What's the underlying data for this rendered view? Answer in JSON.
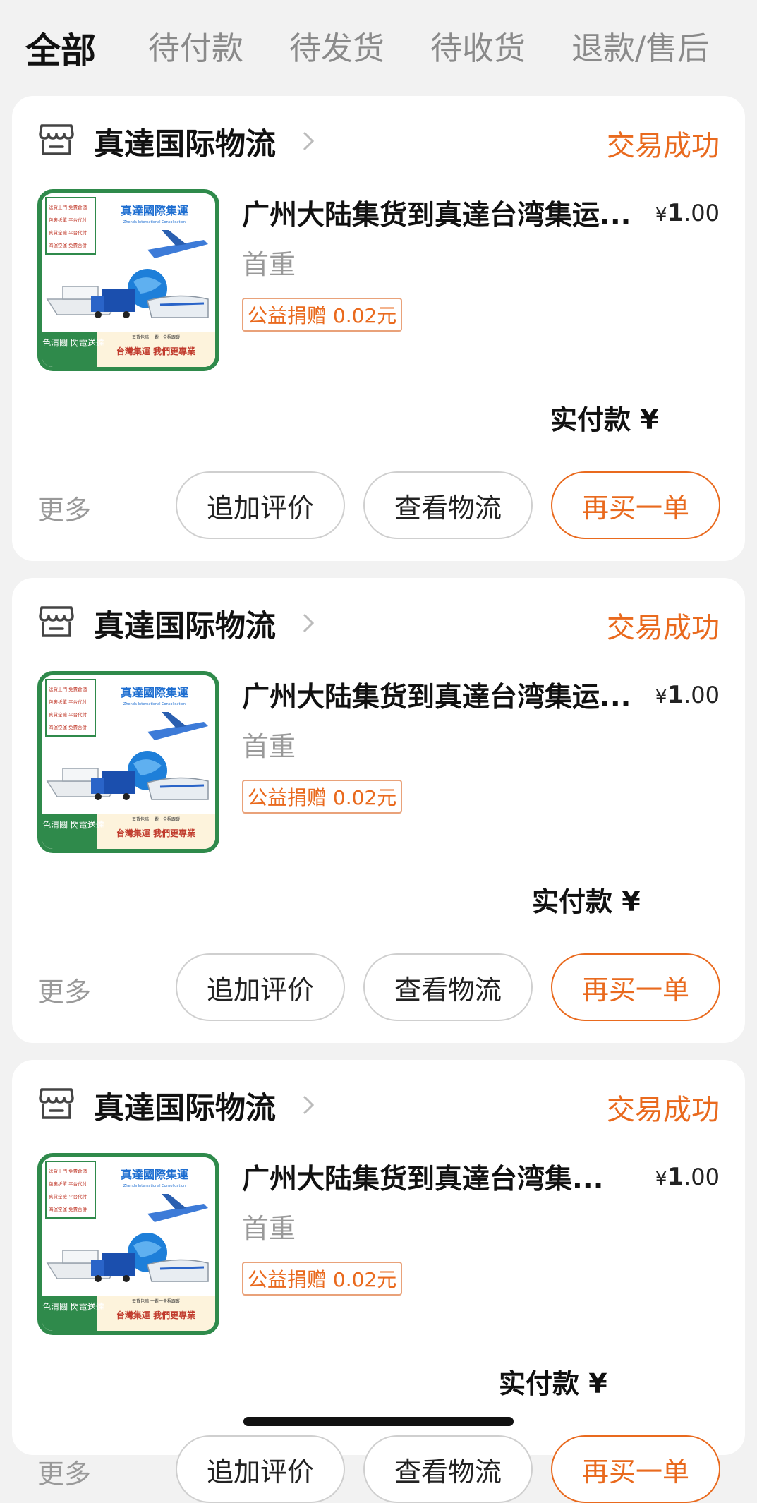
{
  "tabs": [
    {
      "label": "全部",
      "active": true
    },
    {
      "label": "待付款",
      "active": false
    },
    {
      "label": "待发货",
      "active": false
    },
    {
      "label": "待收货",
      "active": false
    },
    {
      "label": "退款/售后",
      "active": false
    }
  ],
  "orders": [
    {
      "shop": "真達国际物流",
      "status": "交易成功",
      "title": "广州大陆集货到真達台湾集运...",
      "price_currency": "¥",
      "price_int": "1",
      "price_dec": ".00",
      "spec": "首重",
      "charity": "公益捐赠 0.02元",
      "paid_label": "实付款 ¥",
      "more": "更多",
      "buttons": [
        "追加评价",
        "查看物流",
        "再买一单"
      ]
    },
    {
      "shop": "真達国际物流",
      "status": "交易成功",
      "title": "广州大陆集货到真達台湾集运...",
      "price_currency": "¥",
      "price_int": "1",
      "price_dec": ".00",
      "spec": "首重",
      "charity": "公益捐赠 0.02元",
      "paid_label": "实付款 ¥",
      "more": "更多",
      "buttons": [
        "追加评价",
        "查看物流",
        "再买一单"
      ]
    },
    {
      "shop": "真達国际物流",
      "status": "交易成功",
      "title": "广州大陆集货到真達台湾集...",
      "price_currency": "¥",
      "price_int": "1",
      "price_dec": ".00",
      "spec": "首重",
      "charity": "公益捐赠 0.02元",
      "paid_label": "实付款 ¥",
      "more": "更多",
      "buttons": [
        "追加评价",
        "查看物流",
        "再买一单"
      ]
    }
  ],
  "thumbnail": {
    "brand": "真達國際集運",
    "brand_en": "Zhenda International Consolidation",
    "features": [
      "送貨上門 免費倉儲",
      "包裹拆單 平台代付",
      "真貨全險 平台代付",
      "海運空運 免費合併"
    ],
    "footer_left": "綠色清關 閃電送達",
    "footer_right": "台灣集運 我們更專業",
    "footer_small": "丟貨包賠 一對一全程跟蹤"
  },
  "colors": {
    "accent": "#e96a1e",
    "brand_green": "#2f8a4b",
    "brand_blue": "#1f6fd1"
  }
}
